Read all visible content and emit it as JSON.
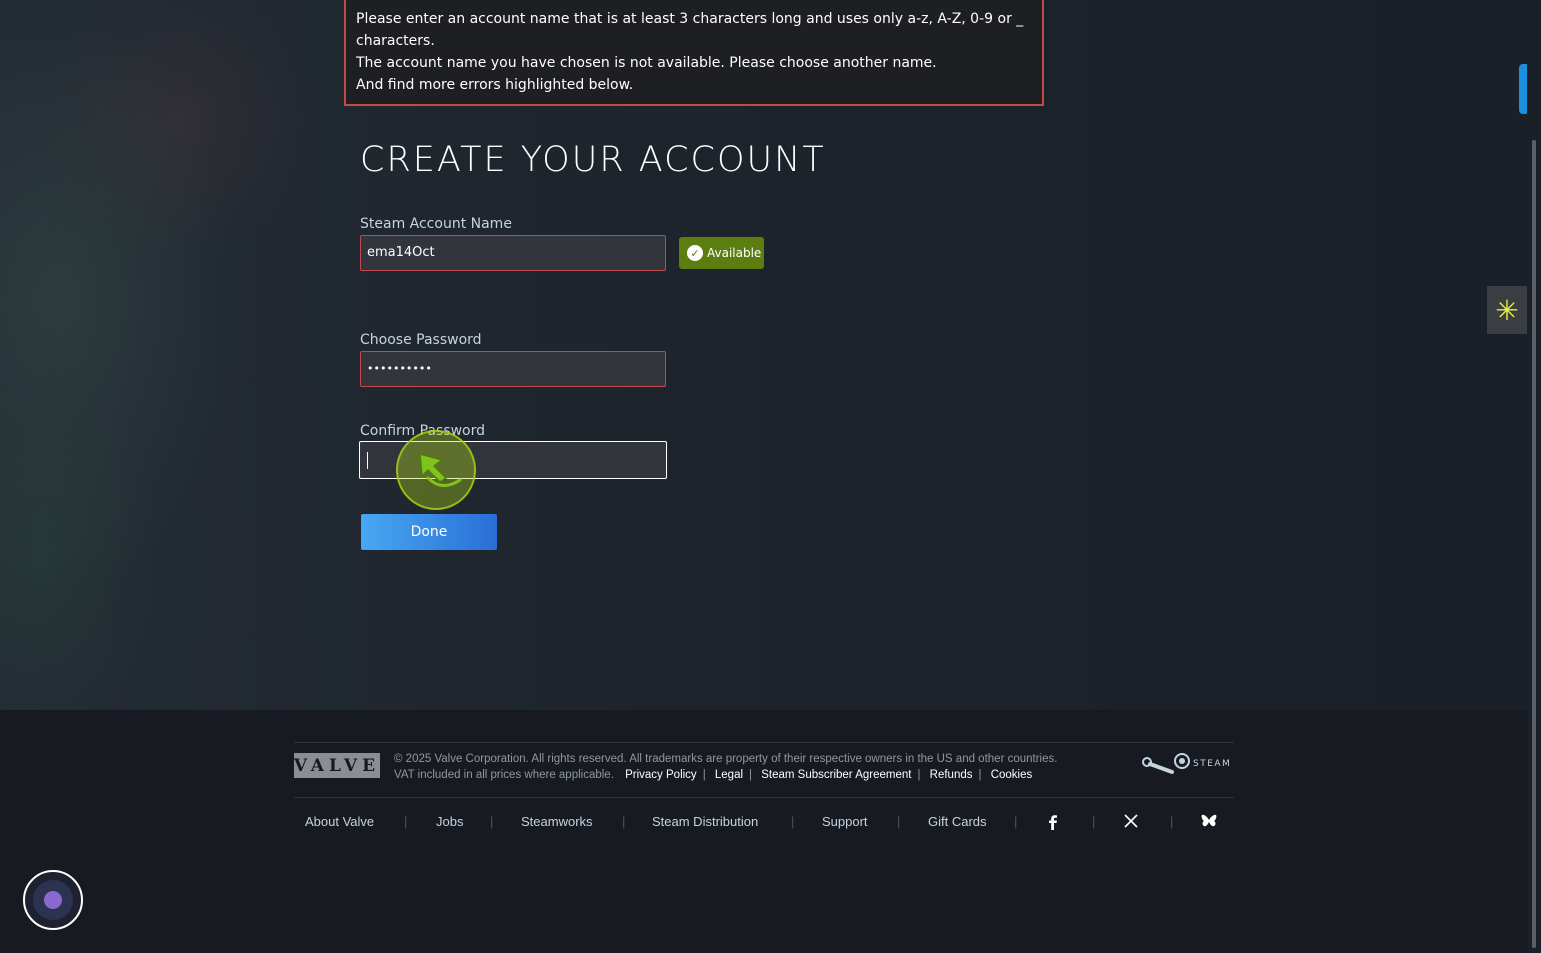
{
  "errors": {
    "line1": "Please enter an account name that is at least 3 characters long and uses only a-z, A-Z, 0-9 or _",
    "line2": "characters.",
    "line3": "The account name you have chosen is not available. Please choose another name.",
    "line4": "And find more errors highlighted below."
  },
  "form": {
    "title": "CREATE YOUR ACCOUNT",
    "account_name_label": "Steam Account Name",
    "account_name_value": "ema14Oct",
    "available_label": "Available",
    "password_label": "Choose Password",
    "password_value": "••••••••••",
    "confirm_label": "Confirm Password",
    "confirm_value": "",
    "done_label": "Done"
  },
  "footer": {
    "valve_logo": "VALVE",
    "copyright": "© 2025 Valve Corporation. All rights reserved. All trademarks are property of their respective owners in the US and other countries.",
    "vat": "VAT included in all prices where applicable.",
    "links": [
      "Privacy Policy",
      "Legal",
      "Steam Subscriber Agreement",
      "Refunds",
      "Cookies"
    ],
    "steam_logo": "STEAM",
    "nav": [
      "About Valve",
      "Jobs",
      "Steamworks",
      "Steam Distribution",
      "Support",
      "Gift Cards"
    ],
    "social_icons": [
      "facebook-icon",
      "x-icon",
      "bluesky-icon"
    ]
  },
  "colors": {
    "error_border": "#c24a4a",
    "available_bg": "#5c7e10",
    "done_gradient_start": "#47a8f2",
    "done_gradient_end": "#2a6ed6"
  }
}
